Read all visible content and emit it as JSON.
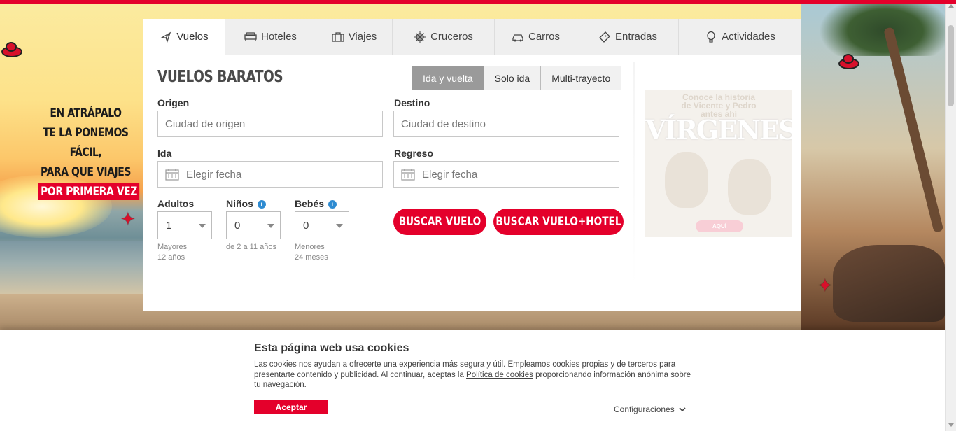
{
  "colors": {
    "brand": "#e4002b",
    "tab_bg": "#efefef",
    "active_toggle": "#9a9a9a"
  },
  "promo": {
    "line1": "EN ATRÁPALO",
    "line2": "TE LA PONEMOS",
    "line3": "FÁCIL,",
    "line4": "PARA QUE VIAJES",
    "highlight": "POR PRIMERA VEZ"
  },
  "tabs": [
    {
      "label": "Vuelos",
      "icon": "plane-icon",
      "active": true
    },
    {
      "label": "Hoteles",
      "icon": "bed-icon"
    },
    {
      "label": "Viajes",
      "icon": "luggage-icon"
    },
    {
      "label": "Cruceros",
      "icon": "ship-wheel-icon"
    },
    {
      "label": "Carros",
      "icon": "car-icon"
    },
    {
      "label": "Entradas",
      "icon": "ticket-icon"
    },
    {
      "label": "Actividades",
      "icon": "balloon-icon"
    }
  ],
  "form": {
    "title": "VUELOS BARATOS",
    "trip_types": [
      "Ida y vuelta",
      "Solo ida",
      "Multi-trayecto"
    ],
    "selected_trip_type": "Ida y vuelta",
    "origin_label": "Origen",
    "origin_placeholder": "Ciudad de origen",
    "destination_label": "Destino",
    "destination_placeholder": "Ciudad de destino",
    "departure_label": "Ida",
    "departure_placeholder": "Elegir fecha",
    "return_label": "Regreso",
    "return_placeholder": "Elegir fecha",
    "adults_label": "Adultos",
    "adults_value": "1",
    "adults_hint_1": "Mayores",
    "adults_hint_2": "12 años",
    "children_label": "Niños",
    "children_value": "0",
    "children_hint": "de 2 a 11 años",
    "infants_label": "Bebés",
    "infants_value": "0",
    "infants_hint_1": "Menores",
    "infants_hint_2": "24 meses",
    "search_flight": "BUSCAR VUELO",
    "search_flight_hotel": "BUSCAR VUELO+HOTEL"
  },
  "ad": {
    "text_1": "Conoce la historia",
    "text_2": "de Vicente y Pedro",
    "text_3": "antes ahí",
    "title": "VÍRGENES",
    "button": "AQUÍ"
  },
  "cookie": {
    "title": "Esta página web usa cookies",
    "text_before_link": "Las cookies nos ayudan a ofrecerte una experiencia más segura y útil. Empleamos cookies propias y de terceros para presentarte contenido y publicidad. Al continuar, aceptas la ",
    "link": "Política de cookies",
    "text_after_link": " proporcionando información anónima sobre tu navegación.",
    "accept": "Aceptar",
    "settings": "Configuraciones"
  }
}
